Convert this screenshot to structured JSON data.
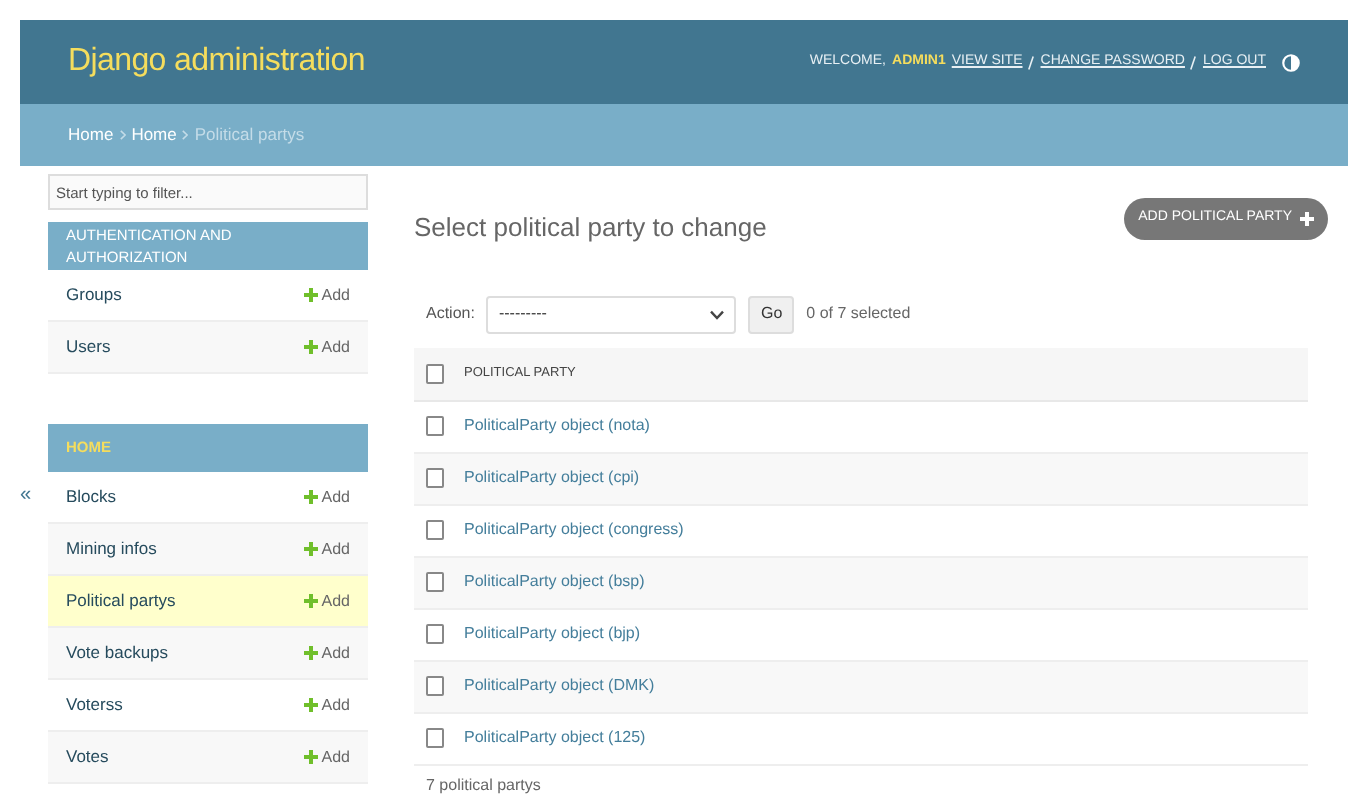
{
  "header": {
    "title": "Django administration",
    "welcome": "WELCOME,",
    "user": "ADMIN1",
    "links": [
      "VIEW SITE",
      "CHANGE PASSWORD",
      "LOG OUT"
    ]
  },
  "breadcrumbs": {
    "links": [
      "Home",
      "Home"
    ],
    "current": "Political partys"
  },
  "sidebar": {
    "filter": {
      "placeholder": "Start typing to filter..."
    },
    "collapse": "«",
    "apps": [
      {
        "name": "AUTHENTICATION AND AUTHORIZATION",
        "selected": false,
        "models": [
          {
            "name": "Groups",
            "add": "Add",
            "selected": false
          },
          {
            "name": "Users",
            "add": "Add",
            "selected": false
          }
        ]
      },
      {
        "name": "HOME",
        "selected": true,
        "models": [
          {
            "name": "Blocks",
            "add": "Add",
            "selected": false
          },
          {
            "name": "Mining infos",
            "add": "Add",
            "selected": false
          },
          {
            "name": "Political partys",
            "add": "Add",
            "selected": true
          },
          {
            "name": "Vote backups",
            "add": "Add",
            "selected": false
          },
          {
            "name": "Voterss",
            "add": "Add",
            "selected": false
          },
          {
            "name": "Votes",
            "add": "Add",
            "selected": false
          }
        ]
      }
    ]
  },
  "content": {
    "title": "Select political party to change",
    "add_button": "ADD POLITICAL PARTY",
    "action": {
      "label": "Action:",
      "value": "---------",
      "go": "Go",
      "counter": "0 of 7 selected"
    },
    "table": {
      "column": "POLITICAL PARTY",
      "header_checked": false,
      "rows": [
        {
          "label": "PoliticalParty object (nota)",
          "checked": false
        },
        {
          "label": "PoliticalParty object (cpi)",
          "checked": false
        },
        {
          "label": "PoliticalParty object (congress)",
          "checked": false
        },
        {
          "label": "PoliticalParty object (bsp)",
          "checked": false
        },
        {
          "label": "PoliticalParty object (bjp)",
          "checked": false
        },
        {
          "label": "PoliticalParty object (DMK)",
          "checked": false
        },
        {
          "label": "PoliticalParty object (125)",
          "checked": false
        }
      ]
    },
    "footer": "7 political partys"
  }
}
